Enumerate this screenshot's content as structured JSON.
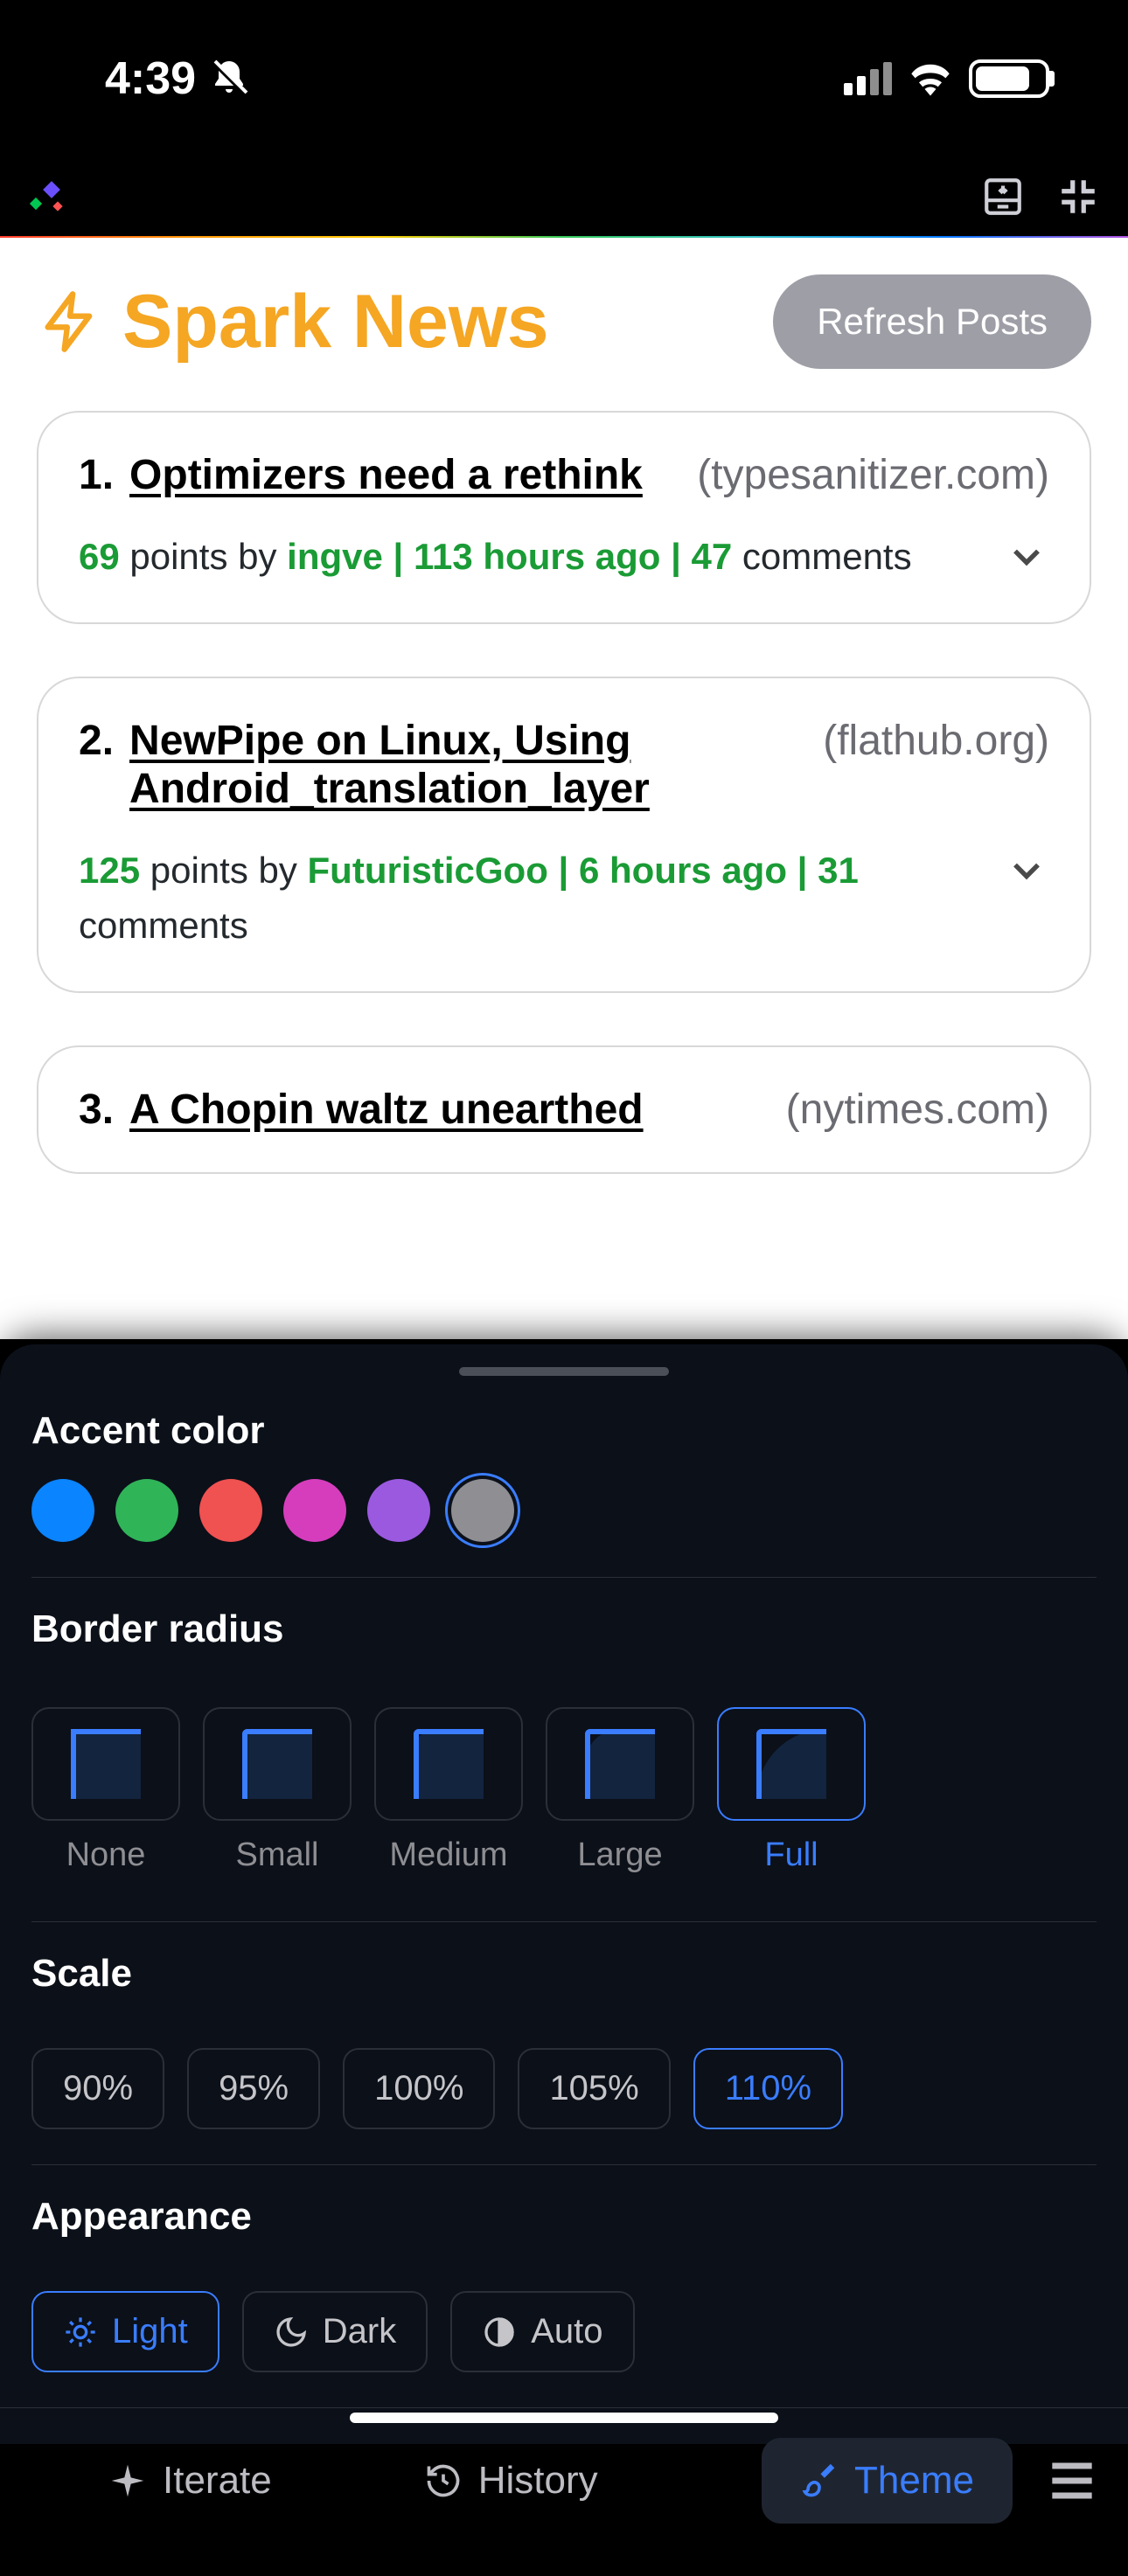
{
  "status": {
    "time": "4:39"
  },
  "app": {
    "title": "Spark News",
    "refresh_label": "Refresh Posts"
  },
  "posts": [
    {
      "index": "1.",
      "title": "Optimizers need a rethink",
      "domain": "(typesanitizer.com)",
      "points": "69",
      "by_label": " points by ",
      "author": "ingve",
      "sep1": " | ",
      "age": "113 hours ago",
      "sep2": " | ",
      "comment_count": "47",
      "comments_label": " comments"
    },
    {
      "index": "2.",
      "title": "NewPipe on Linux, Using Android_translation_layer",
      "domain": "(flathub.org)",
      "points": "125",
      "by_label": " points by ",
      "author": "FuturisticGoo",
      "sep1": " | ",
      "age": "6 hours ago",
      "sep2": " | ",
      "comment_count": "31",
      "comments_label": " comments"
    },
    {
      "index": "3.",
      "title": "A Chopin waltz unearthed",
      "domain": "(nytimes.com)"
    }
  ],
  "sheet": {
    "accent_label": "Accent color",
    "accent_options": [
      "blue",
      "green",
      "red",
      "pink",
      "purple",
      "gray"
    ],
    "accent_selected": "gray",
    "radius_label": "Border radius",
    "radius": {
      "none": "None",
      "small": "Small",
      "medium": "Medium",
      "large": "Large",
      "full": "Full"
    },
    "radius_selected": "Full",
    "scale_label": "Scale",
    "scale_options": [
      "90%",
      "95%",
      "100%",
      "105%",
      "110%"
    ],
    "scale_selected": "110%",
    "appearance_label": "Appearance",
    "appearance": {
      "light": "Light",
      "dark": "Dark",
      "auto": "Auto"
    },
    "appearance_selected": "Light"
  },
  "footer": {
    "iterate": "Iterate",
    "history": "History",
    "theme": "Theme"
  }
}
